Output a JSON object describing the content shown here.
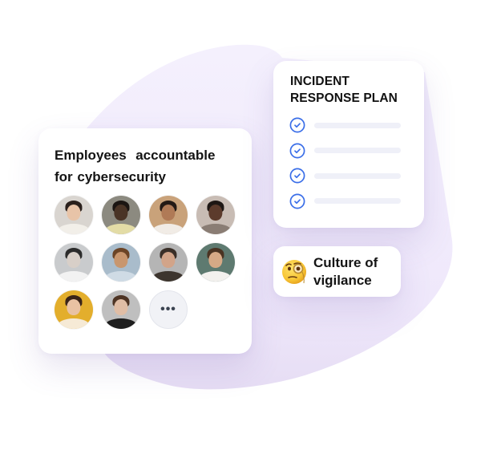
{
  "employees_card": {
    "title_line1": "Employees  accountable",
    "title_line2": "for cybersecurity",
    "avatars": [
      {
        "name": "avatar-woman-white-top-red-flower",
        "bg": "#d9d5d0",
        "skin": "#e8c4a8",
        "hair": "#2a201c",
        "shirt": "#f2efe9"
      },
      {
        "name": "avatar-man-yellow-shirt",
        "bg": "#8c8a80",
        "skin": "#4a3426",
        "hair": "#1b1512",
        "shirt": "#e3dca6"
      },
      {
        "name": "avatar-woman-curly-hair",
        "bg": "#c9a27a",
        "skin": "#b07a56",
        "hair": "#241a15",
        "shirt": "#f1ece6"
      },
      {
        "name": "avatar-woman-afro",
        "bg": "#c8bcb4",
        "skin": "#5c3b2c",
        "hair": "#1e1714",
        "shirt": "#8a7d74"
      },
      {
        "name": "avatar-woman-profile-bw",
        "bg": "#c9cbcd",
        "skin": "#d8cfc8",
        "hair": "#2b2b2b",
        "shirt": "#f2f2f2"
      },
      {
        "name": "avatar-woman-long-wavy-hair",
        "bg": "#a9bccb",
        "skin": "#c8966e",
        "hair": "#6b4426",
        "shirt": "#cfdbe5"
      },
      {
        "name": "avatar-man-beard-smiling",
        "bg": "#b5b5b5",
        "skin": "#d2a489",
        "hair": "#3a2f28",
        "shirt": "#3d352e"
      },
      {
        "name": "avatar-man-white-tshirt",
        "bg": "#5e7a70",
        "skin": "#d6a986",
        "hair": "#4a3322",
        "shirt": "#f3f1ee"
      },
      {
        "name": "avatar-woman-yellow-background",
        "bg": "#e3ae2c",
        "skin": "#e9c2a3",
        "hair": "#3a2418",
        "shirt": "#f6ead6"
      },
      {
        "name": "avatar-woman-long-straight-hair",
        "bg": "#bfbfbf",
        "skin": "#e0bda5",
        "hair": "#4e3424",
        "shirt": "#1e1e1e"
      }
    ],
    "more_label": "•••"
  },
  "incident_card": {
    "title_line1": "INCIDENT",
    "title_line2": "RESPONSE PLAN",
    "items": [
      {
        "icon": "check-circle-icon",
        "checked": true
      },
      {
        "icon": "check-circle-icon",
        "checked": true
      },
      {
        "icon": "check-circle-icon",
        "checked": true
      },
      {
        "icon": "check-circle-icon",
        "checked": true
      }
    ],
    "check_color": "#3a6ee8",
    "bar_color": "#eff0f8"
  },
  "vigilance_card": {
    "emoji": "face-with-monocle-icon",
    "text_line1": "Culture of",
    "text_line2": "vigilance"
  },
  "colors": {
    "blob": "#f3eefc",
    "blob_shadow": "#e6dcf5",
    "text": "#141414"
  }
}
